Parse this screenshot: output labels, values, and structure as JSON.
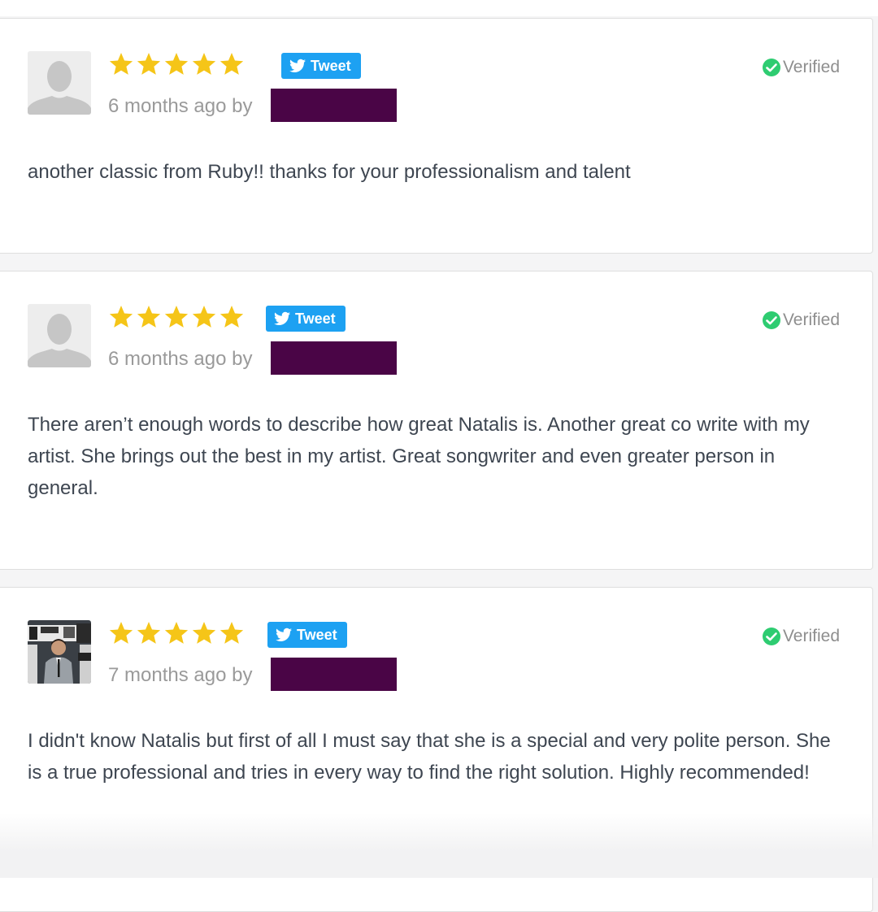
{
  "colors": {
    "star": "#f5c518",
    "tweet_button": "#1da1f2",
    "verified_icon": "#2ecc71",
    "redaction": "#4a0546"
  },
  "reviews": [
    {
      "avatar": "default-person-icon",
      "rating": 5,
      "tweet_label": "Tweet",
      "verified_label": "Verified",
      "time_by": "6 months ago by",
      "text": "another classic from Ruby!! thanks for your professionalism and talent"
    },
    {
      "avatar": "default-person-icon",
      "rating": 5,
      "tweet_label": "Tweet",
      "verified_label": "Verified",
      "time_by": "6 months ago by",
      "text": "There aren’t enough words to describe how great Natalis is. Another great co write with my artist. She brings out the best in my artist. Great songwriter and even greater person in general."
    },
    {
      "avatar": "user-photo",
      "rating": 5,
      "tweet_label": "Tweet",
      "verified_label": "Verified",
      "time_by": "7 months ago by",
      "text": "I didn't know Natalis but first of all I must say that she is a special and very polite person. She is a true professional and tries in every way to find the right solution. Highly recommended!"
    }
  ]
}
